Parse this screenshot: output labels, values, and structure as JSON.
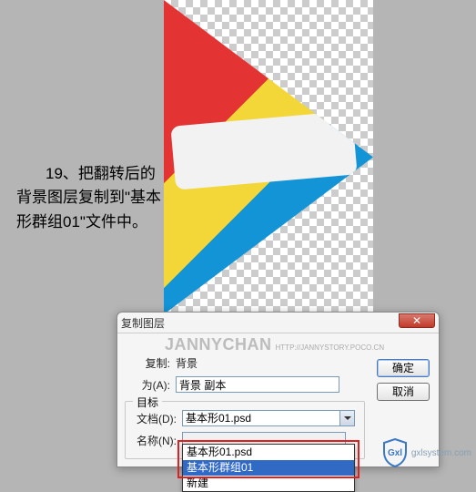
{
  "instruction": {
    "line1_prefix": "19、",
    "text": "把翻转后的背景图层复制到\"基本形群组01\"文件中。"
  },
  "dialog": {
    "title": "复制图层",
    "watermark": {
      "brand": "JANNYCHAN",
      "url": "HTTP://JANNYSTORY.POCO.CN"
    },
    "copy_label": "复制:",
    "copy_value": "背景",
    "as_label": "为(A):",
    "as_value": "背景 副本",
    "target_legend": "目标",
    "document_label": "文档(D):",
    "document_value": "基本形01.psd",
    "name_label": "名称(N):",
    "dropdown": {
      "items": [
        {
          "label": "基本形01.psd",
          "selected": false
        },
        {
          "label": "基本形群组01",
          "selected": true
        },
        {
          "label": "新建",
          "selected": false
        }
      ]
    },
    "buttons": {
      "ok": "确定",
      "cancel": "取消"
    },
    "close_icon": "✕"
  },
  "badge": {
    "brand": "Gxl",
    "site": "gxlsystem.com"
  }
}
